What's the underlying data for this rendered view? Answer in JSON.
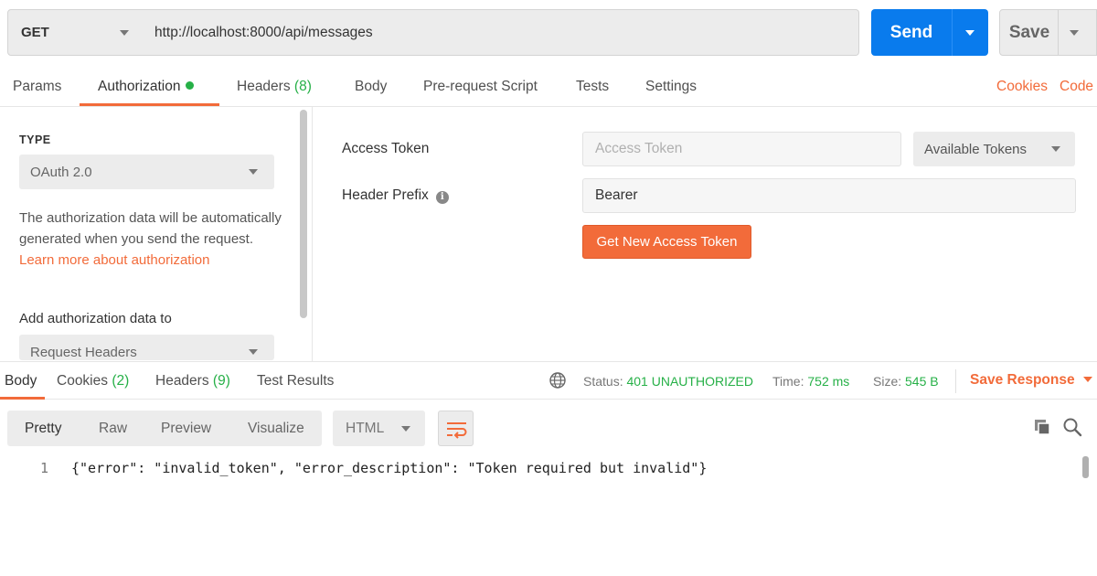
{
  "request": {
    "method": "GET",
    "url": "http://localhost:8000/api/messages",
    "send_label": "Send",
    "save_label": "Save"
  },
  "request_tabs": {
    "params": "Params",
    "authorization": "Authorization",
    "headers": "Headers",
    "headers_count": "(8)",
    "body": "Body",
    "prerequest": "Pre-request Script",
    "tests": "Tests",
    "settings": "Settings",
    "cookies": "Cookies",
    "code": "Code"
  },
  "auth": {
    "type_label": "TYPE",
    "type_value": "OAuth 2.0",
    "description": "The authorization data will be automatically generated when you send the request.",
    "learn_more": "Learn more about authorization",
    "add_to_label": "Add authorization data to",
    "add_to_value": "Request Headers",
    "access_token_label": "Access Token",
    "access_token_placeholder": "Access Token",
    "available_tokens": "Available Tokens",
    "header_prefix_label": "Header Prefix",
    "header_prefix_value": "Bearer",
    "get_token_button": "Get New Access Token"
  },
  "response": {
    "tabs": {
      "body": "Body",
      "cookies": "Cookies",
      "cookies_count": "(2)",
      "headers": "Headers",
      "headers_count": "(9)",
      "test_results": "Test Results"
    },
    "status_label": "Status:",
    "status_value": "401 UNAUTHORIZED",
    "time_label": "Time:",
    "time_value": "752 ms",
    "size_label": "Size:",
    "size_value": "545 B",
    "save_response": "Save Response",
    "view_modes": [
      "Pretty",
      "Raw",
      "Preview",
      "Visualize"
    ],
    "format": "HTML",
    "line_number": "1",
    "body_text": "{\"error\": \"invalid_token\", \"error_description\": \"Token required but invalid\"}"
  },
  "colors": {
    "accent": "#f26b3a",
    "send_blue": "#097bed",
    "success_green": "#26b047"
  }
}
